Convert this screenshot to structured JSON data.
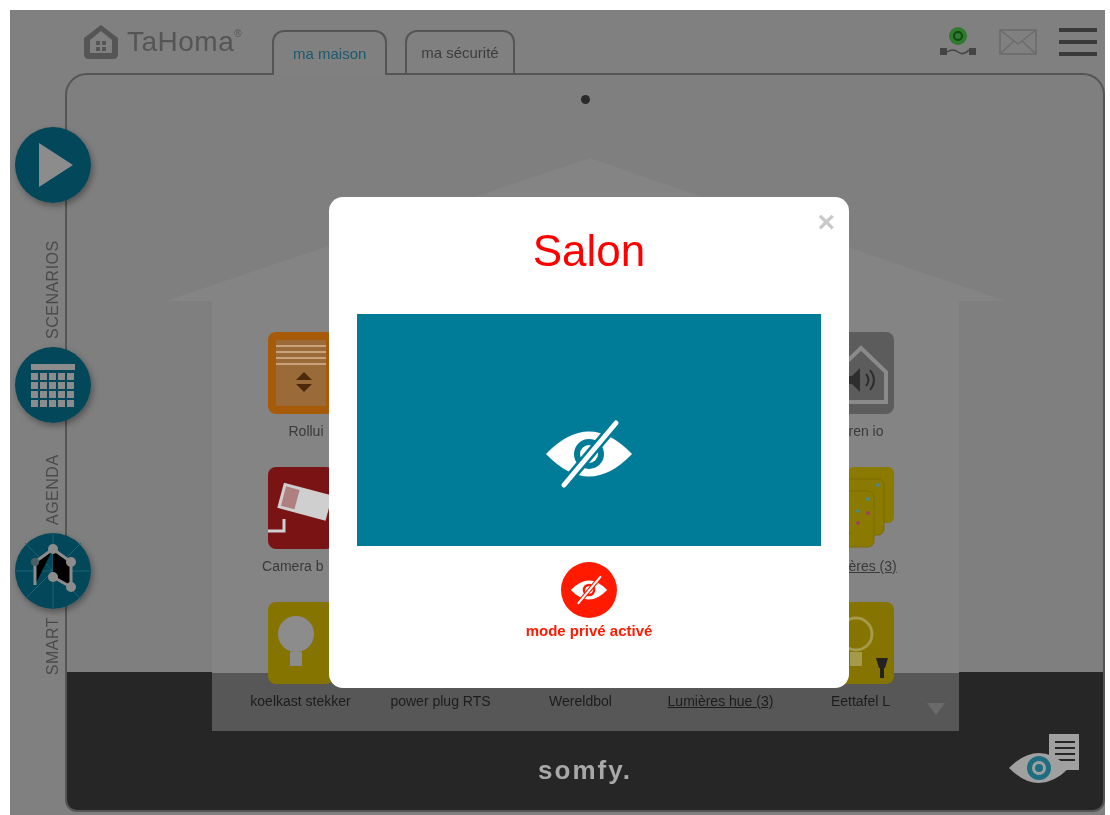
{
  "header": {
    "logo": "TaHoma$^{®}$"
  },
  "tabs": [
    {
      "label": "ma maison",
      "selected": true
    },
    {
      "label": "ma sécurité",
      "selected": false
    }
  ],
  "rail": [
    {
      "label": "SCENARIOS",
      "kind": "play"
    },
    {
      "label": "AGENDA",
      "kind": "calendar"
    },
    {
      "label": "SMART",
      "kind": "network"
    }
  ],
  "devices": [
    {
      "label": "Rollui",
      "kind": "shutter",
      "group": false
    },
    {
      "kind": "blank"
    },
    {
      "kind": "blank"
    },
    {
      "kind": "blank"
    },
    {
      "label": "ren io",
      "kind": "siren",
      "group": false
    },
    {
      "label": "Camera b",
      "kind": "camera",
      "group": false
    },
    {
      "kind": "blank"
    },
    {
      "kind": "blank"
    },
    {
      "kind": "blank"
    },
    {
      "label": "ères (3)",
      "kind": "lights",
      "group": true
    },
    {
      "label": "koelkast stekker",
      "kind": "bulb",
      "group": false
    },
    {
      "label": "power plug RTS",
      "kind": "hidden",
      "group": false
    },
    {
      "label": "Wereldbol",
      "kind": "hidden",
      "group": false
    },
    {
      "label": "Lumières hue (3)",
      "kind": "hidden",
      "group": true
    },
    {
      "label": "Eettafel L",
      "kind": "bulb_plug",
      "group": false
    }
  ],
  "modal": {
    "title": "Salon",
    "close": "×",
    "status": "mode privé activé"
  },
  "footer": {
    "brand": "somfy."
  }
}
